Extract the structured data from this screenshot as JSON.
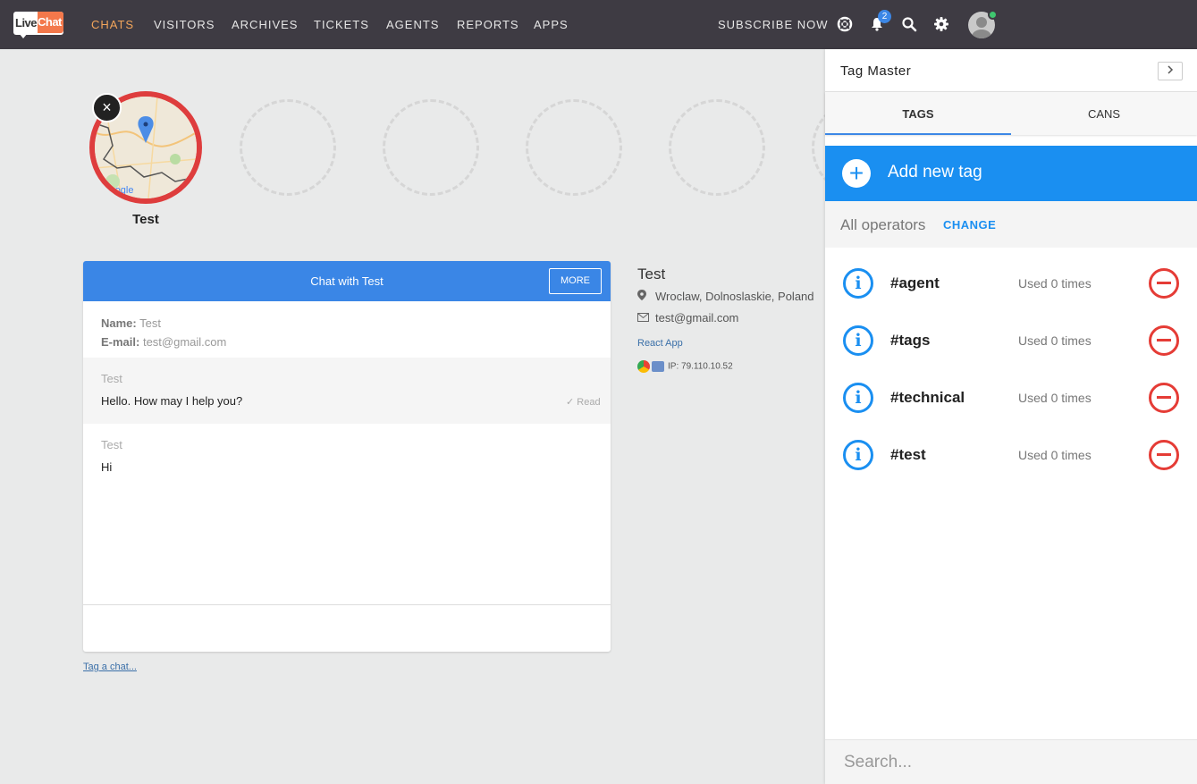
{
  "app": {
    "logo_left": "Live",
    "logo_right": "Chat"
  },
  "nav": {
    "items": [
      {
        "label": "CHATS",
        "active": true
      },
      {
        "label": "VISITORS"
      },
      {
        "label": "ARCHIVES"
      },
      {
        "label": "TICKETS"
      },
      {
        "label": "AGENTS"
      },
      {
        "label": "REPORTS"
      },
      {
        "label": "APPS"
      }
    ],
    "subscribe": "SUBSCRIBE NOW",
    "notifications_count": "2"
  },
  "visitor": {
    "name": "Test",
    "close_symbol": "×",
    "map_brand": "Google"
  },
  "chat": {
    "title": "Chat with Test",
    "more": "MORE",
    "name_label": "Name:",
    "name_value": "Test",
    "email_label": "E-mail:",
    "email_value": "test@gmail.com",
    "messages": [
      {
        "author": "Test",
        "text": "Hello. How may I help you?",
        "status": "Read"
      },
      {
        "author": "Test",
        "text": "Hi"
      }
    ],
    "tag_link": "Tag a chat..."
  },
  "details": {
    "name": "Test",
    "location": "Wroclaw, Dolnoslaskie, Poland",
    "email": "test@gmail.com",
    "app": "React App",
    "ip": "IP: 79.110.10.52"
  },
  "panel": {
    "title": "Tag Master",
    "collapse_symbol": "›",
    "tabs": [
      {
        "label": "TAGS",
        "active": true
      },
      {
        "label": "CANS"
      }
    ],
    "add_tag": "Add new tag",
    "operators_label": "All operators",
    "operators_change": "CHANGE",
    "tags": [
      {
        "name": "#agent",
        "used": "Used 0 times"
      },
      {
        "name": "#tags",
        "used": "Used 0 times"
      },
      {
        "name": "#technical",
        "used": "Used 0 times"
      },
      {
        "name": "#test",
        "used": "Used 0 times"
      }
    ],
    "search_placeholder": "Search..."
  },
  "colors": {
    "topbar": "#3e3b43",
    "nav_active": "#f2a55b",
    "chat_header": "#3a86e6",
    "add_tag_bg": "#1a8ff1",
    "remove_red": "#e53c36",
    "visitor_ring": "#de3d3d",
    "online_green": "#3fc66f"
  },
  "icons": [
    "support-icon",
    "bell-icon",
    "search-icon",
    "gear-icon",
    "user-avatar",
    "map-pin-icon",
    "envelope-icon",
    "info-icon",
    "remove-icon",
    "plus-icon",
    "chevron-right-icon"
  ]
}
